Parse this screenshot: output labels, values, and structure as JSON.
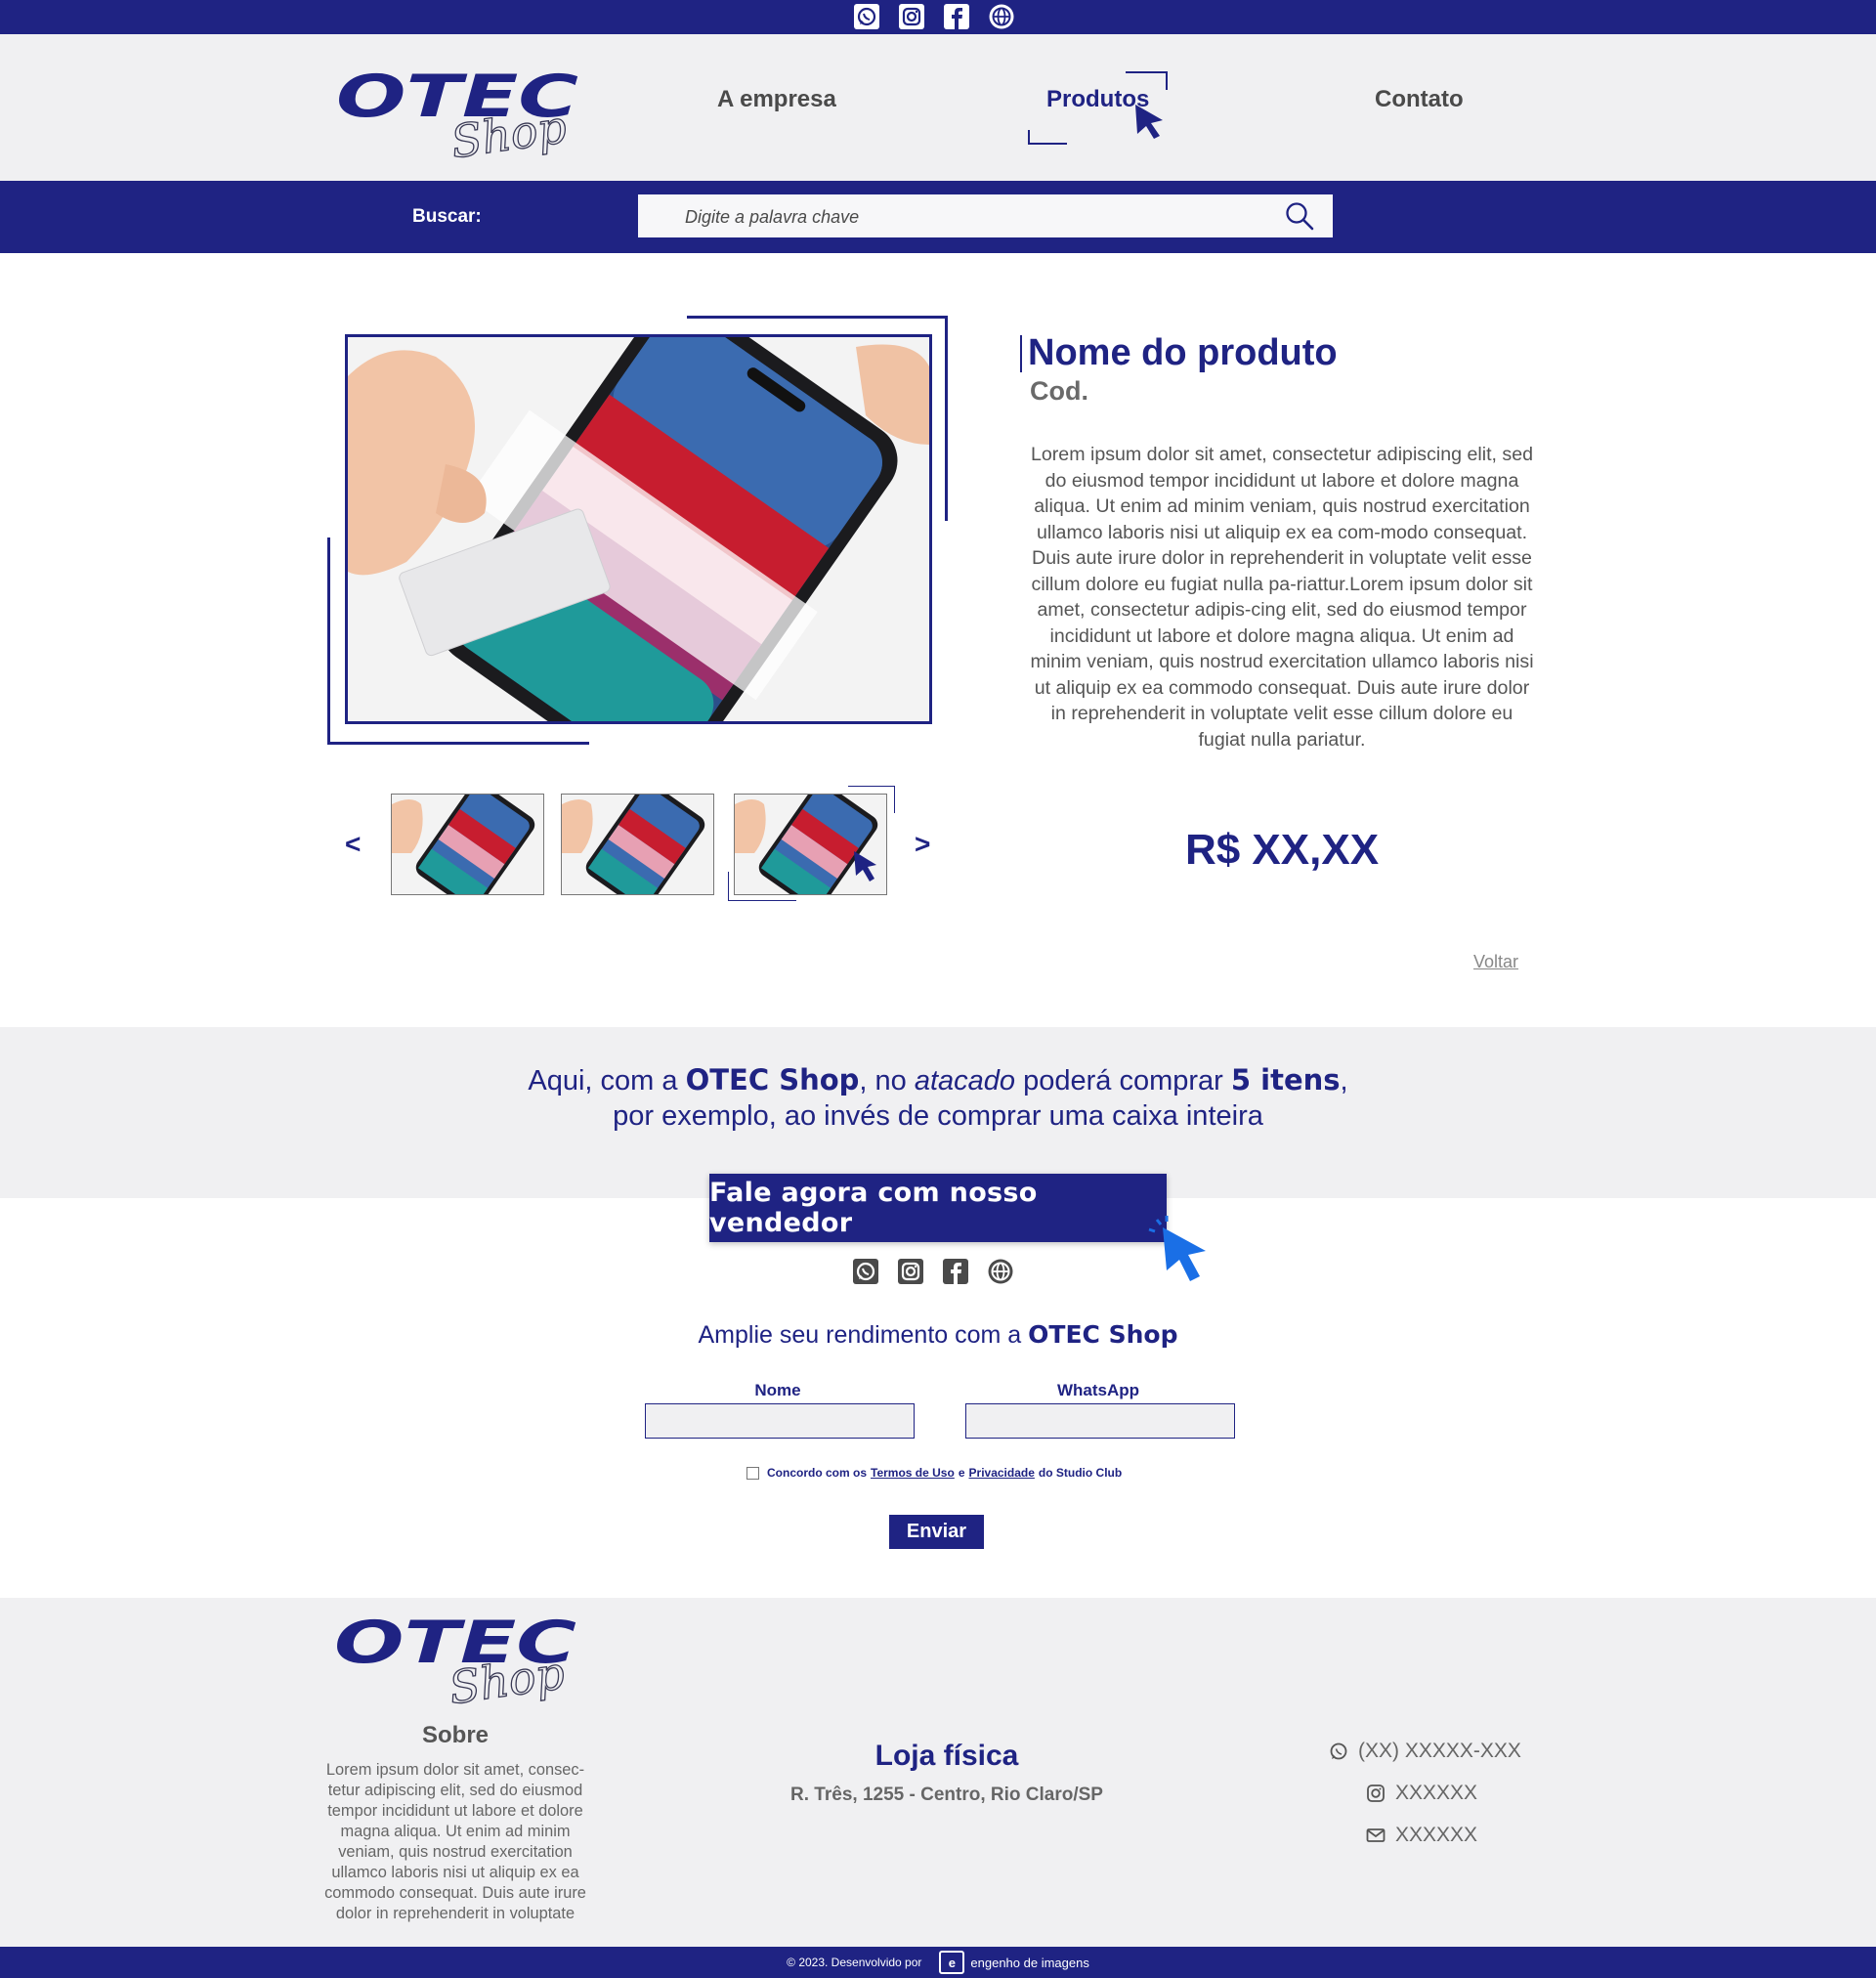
{
  "social": [
    "whatsapp-icon",
    "instagram-icon",
    "facebook-icon",
    "globe-icon"
  ],
  "brand": {
    "logo_text": "OTEC",
    "logo_script": "Shop"
  },
  "nav": {
    "empresa": "A empresa",
    "produtos": "Produtos",
    "contato": "Contato"
  },
  "search": {
    "label": "Buscar:",
    "placeholder": "Digite a palavra chave"
  },
  "product": {
    "title": "Nome do produto",
    "code": "Cod.",
    "description": "Lorem ipsum dolor sit amet, consectetur adipiscing elit, sed do eiusmod tempor incididunt ut labore et dolore magna aliqua. Ut enim ad minim veniam, quis nostrud exercitation ullamco laboris nisi ut aliquip ex ea com-modo consequat. Duis aute irure dolor in reprehenderit in voluptate velit esse cillum dolore eu fugiat nulla pa-riattur.Lorem ipsum dolor sit amet, consectetur adipis-cing elit, sed do eiusmod tempor incididunt ut labore et dolore magna aliqua. Ut enim ad minim veniam, quis nostrud exercitation ullamco laboris nisi ut aliquip ex ea commodo consequat. Duis aute irure dolor in reprehenderit in voluptate velit esse cillum dolore eu fugiat nulla pariatur.",
    "price": "R$ XX,XX",
    "back": "Voltar",
    "prev": "<",
    "next": ">"
  },
  "promo": {
    "p1": "Aqui, com a ",
    "b1": "OTEC Shop",
    "p2": ", no ",
    "i1": "atacado",
    "p3": " poderá comprar ",
    "b2": "5 itens",
    "p4": ",",
    "line2": "por exemplo, ao invés de comprar uma caixa inteira",
    "cta": "Fale agora com nosso vendedor"
  },
  "form": {
    "heading": "Amplie seu rendimento com a ",
    "heading_brand": "OTEC Shop",
    "name_label": "Nome",
    "whatsapp_label": "WhatsApp",
    "name_value": "",
    "whatsapp_value": "",
    "consent_1": "Concordo com os ",
    "terms": "Termos de Uso",
    "consent_2": " e ",
    "privacy": "Privacidade ",
    "consent_3": "do Studio Club",
    "submit": "Enviar"
  },
  "footer": {
    "sobre_title": "Sobre",
    "sobre_text": "Lorem ipsum dolor sit amet, consec-tetur adipiscing elit, sed do eiusmod tempor incididunt ut labore et dolore magna aliqua. Ut enim ad minim veniam, quis nostrud exercitation ullamco laboris nisi ut aliquip ex ea commodo consequat. Duis aute irure dolor in reprehenderit in voluptate",
    "loja_title": "Loja física",
    "loja_addr": "R. Três, 1255 - Centro, Rio Claro/SP",
    "phone": "(XX) XXXXX-XXX",
    "instagram": "XXXXXX",
    "email": "XXXXXX",
    "copyright": "© 2023. Desenvolvido por",
    "dev_mark": "e",
    "dev_name": "engenho de imagens"
  },
  "colors": {
    "primary": "#1f2383",
    "band": "#f0f0f2",
    "text": "#4a4a4a"
  }
}
